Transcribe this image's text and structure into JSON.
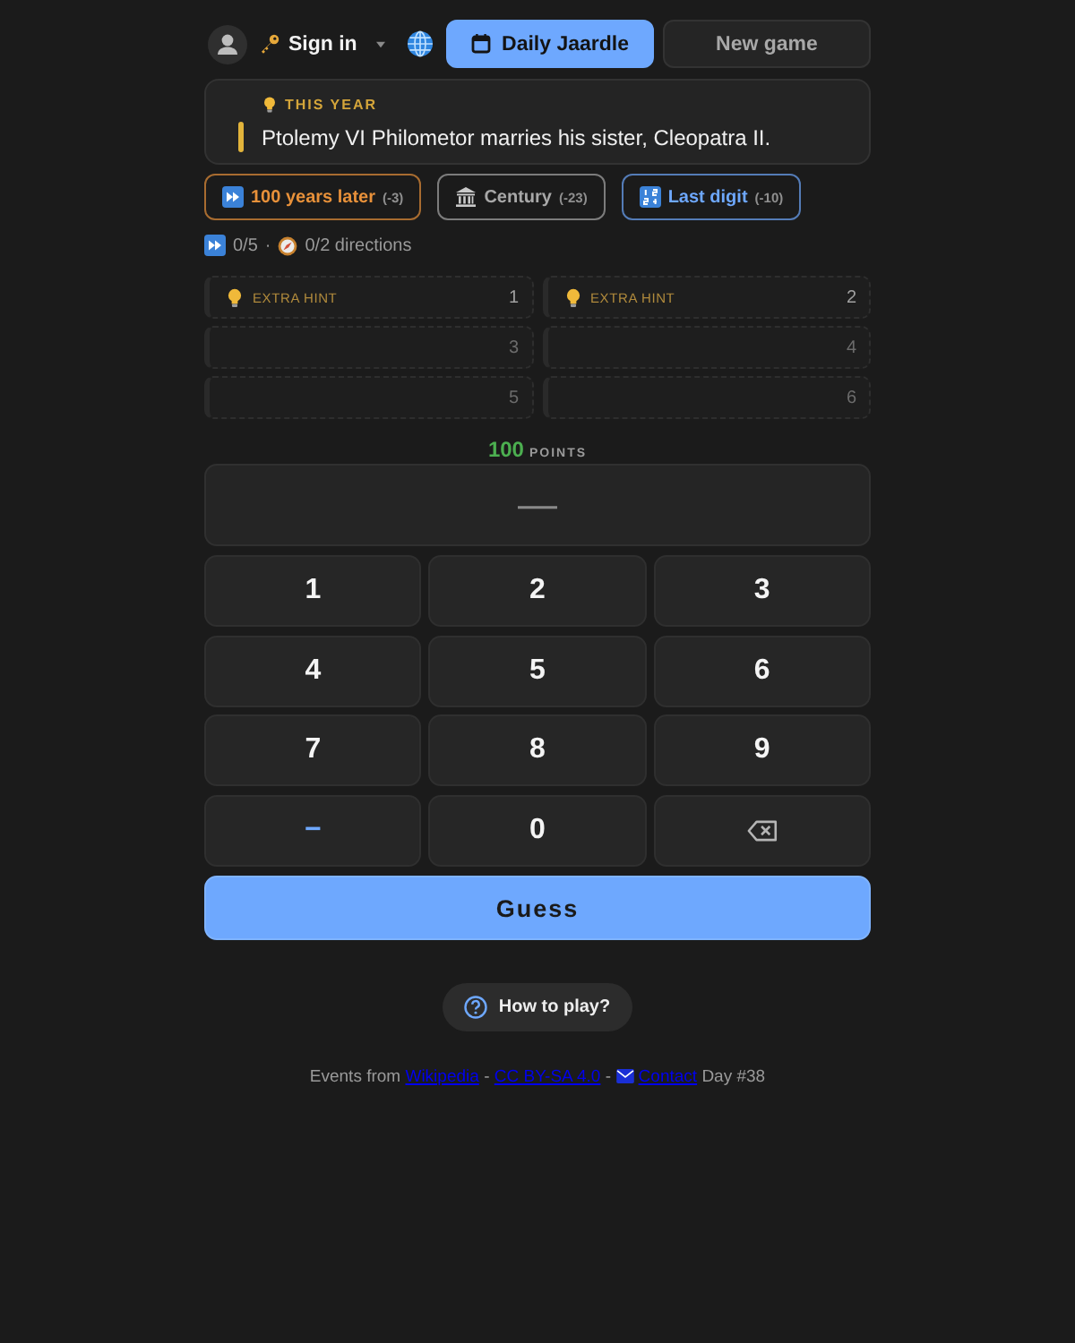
{
  "header": {
    "sign_in": "Sign in",
    "modes": [
      {
        "kind": "daily",
        "label": "Daily Jaardle",
        "selected": true
      },
      {
        "kind": "new",
        "label": "New game",
        "selected": false
      }
    ]
  },
  "event_card": {
    "label": "THIS YEAR",
    "text": "Ptolemy VI Philometor marries his sister, Cleopatra II."
  },
  "hint_buttons": [
    {
      "kind": "later",
      "label": "100 years later",
      "cost": "(-3)",
      "color": "#e8913a"
    },
    {
      "kind": "century",
      "label": "Century",
      "cost": "(-23)",
      "color": "#a8a8a8"
    },
    {
      "kind": "digit",
      "label": "Last digit",
      "cost": "(-10)",
      "color": "#6ea8fe"
    }
  ],
  "progress": {
    "skips": "0/5",
    "separator": "·",
    "directions": "0/2 directions"
  },
  "extra_hints": [
    {
      "label": "EXTRA HINT",
      "number": "1"
    },
    {
      "label": "EXTRA HINT",
      "number": "2"
    },
    {
      "number": "3"
    },
    {
      "number": "4"
    },
    {
      "number": "5"
    },
    {
      "number": "6"
    }
  ],
  "points": {
    "value": "100",
    "unit": "POINTS"
  },
  "answer": {
    "placeholder": "—"
  },
  "keypad": [
    {
      "kind": "digit",
      "label": "1"
    },
    {
      "kind": "digit",
      "label": "2"
    },
    {
      "kind": "digit",
      "label": "3"
    },
    {
      "kind": "digit",
      "label": "4"
    },
    {
      "kind": "digit",
      "label": "5"
    },
    {
      "kind": "digit",
      "label": "6"
    },
    {
      "kind": "digit",
      "label": "7"
    },
    {
      "kind": "digit",
      "label": "8"
    },
    {
      "kind": "digit",
      "label": "9"
    },
    {
      "kind": "sign",
      "label": "−"
    },
    {
      "kind": "digit",
      "label": "0"
    },
    {
      "kind": "backspace"
    }
  ],
  "guess_button": "Guess",
  "help_button": "How to play?",
  "footer": [
    {
      "kind": "text",
      "text": "Events from"
    },
    {
      "kind": "link",
      "text": "Wikipedia"
    },
    {
      "kind": "text",
      "text": "-"
    },
    {
      "kind": "link",
      "text": "CC BY-SA 4.0"
    },
    {
      "kind": "text",
      "text": "-"
    },
    {
      "kind": "envelope"
    },
    {
      "kind": "link",
      "text": "Contact"
    },
    {
      "kind": "text",
      "text": "Day #38"
    }
  ]
}
